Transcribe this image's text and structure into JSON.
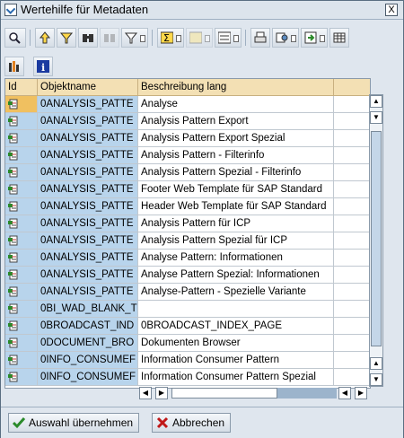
{
  "window": {
    "title": "Wertehilfe für Metadaten",
    "close_symbol": "X"
  },
  "toolbar": {
    "row1": [
      {
        "name": "find-icon"
      },
      {
        "name": "sort-ascending-icon"
      },
      {
        "name": "filter-icon"
      },
      {
        "name": "search-binoculars-icon"
      },
      {
        "name": "find-next-icon"
      },
      {
        "name": "set-filter-icon"
      },
      {
        "name": "sum-icon"
      },
      {
        "name": "subtotals-icon"
      },
      {
        "name": "calculation-icon"
      },
      {
        "name": "print-icon"
      },
      {
        "name": "views-icon"
      },
      {
        "name": "export-icon"
      },
      {
        "name": "layout-icon"
      }
    ],
    "row2": [
      {
        "name": "column-settings-icon"
      },
      {
        "name": "information-icon"
      }
    ]
  },
  "grid": {
    "columns": [
      "Id",
      "Objektname",
      "Beschreibung lang"
    ],
    "rows": [
      {
        "obj": "0ANALYSIS_PATTE",
        "desc": "Analyse",
        "selected": true
      },
      {
        "obj": "0ANALYSIS_PATTE",
        "desc": "Analysis Pattern Export"
      },
      {
        "obj": "0ANALYSIS_PATTE",
        "desc": "Analysis Pattern Export Spezial"
      },
      {
        "obj": "0ANALYSIS_PATTE",
        "desc": "Analysis Pattern - Filterinfo"
      },
      {
        "obj": "0ANALYSIS_PATTE",
        "desc": "Analysis Pattern Spezial - Filterinfo"
      },
      {
        "obj": "0ANALYSIS_PATTE",
        "desc": "Footer  Web Template für SAP Standard"
      },
      {
        "obj": "0ANALYSIS_PATTE",
        "desc": "Header Web Template für SAP Standard"
      },
      {
        "obj": "0ANALYSIS_PATTE",
        "desc": "Analysis Pattern für ICP"
      },
      {
        "obj": "0ANALYSIS_PATTE",
        "desc": "Analysis Pattern Spezial für ICP"
      },
      {
        "obj": "0ANALYSIS_PATTE",
        "desc": "Analyse Pattern: Informationen"
      },
      {
        "obj": "0ANALYSIS_PATTE",
        "desc": "Analyse Pattern Spezial: Informationen"
      },
      {
        "obj": "0ANALYSIS_PATTE",
        "desc": "Analyse-Pattern - Spezielle Variante"
      },
      {
        "obj": "0BI_WAD_BLANK_T",
        "desc": ""
      },
      {
        "obj": "0BROADCAST_IND",
        "desc": "0BROADCAST_INDEX_PAGE"
      },
      {
        "obj": "0DOCUMENT_BRO",
        "desc": "Dokumenten Browser"
      },
      {
        "obj": "0INFO_CONSUMEF",
        "desc": "Information Consumer Pattern"
      },
      {
        "obj": "0INFO_CONSUMEF",
        "desc": "Information Consumer Pattern Spezial"
      }
    ]
  },
  "footer": {
    "accept_label": "Auswahl übernehmen",
    "cancel_label": "Abbrechen"
  },
  "colors": {
    "header_bg": "#f3e0b4",
    "key_column_bg": "#b8d4ec",
    "selected_cell_bg": "#f0c060"
  }
}
